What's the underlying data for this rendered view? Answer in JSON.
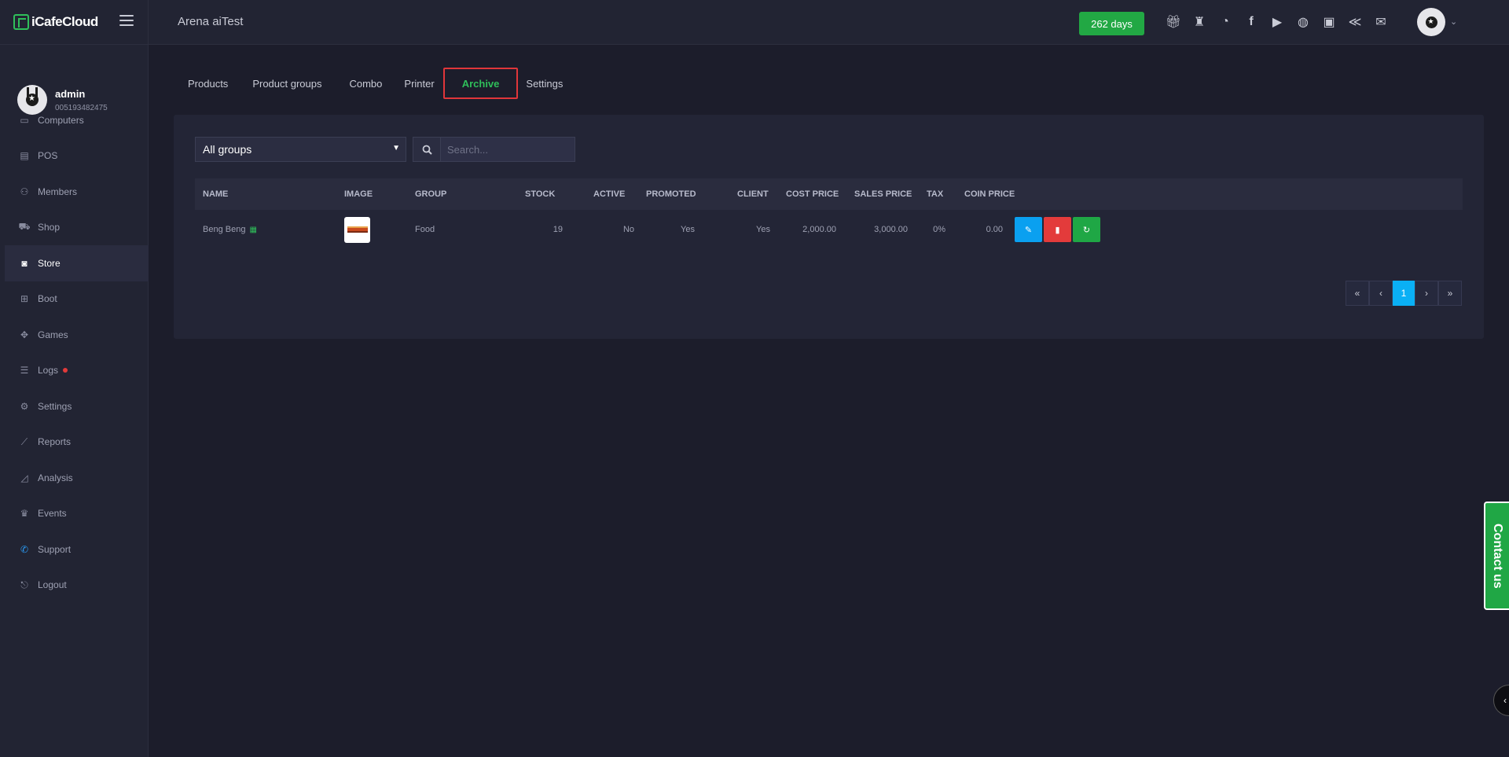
{
  "brand": {
    "name": "iCafeCloud"
  },
  "user": {
    "name": "admin",
    "phone": "005193482475"
  },
  "sidebar": {
    "items": [
      {
        "label": "Computers",
        "icon": "monitor-icon"
      },
      {
        "label": "POS",
        "icon": "cash-register-icon"
      },
      {
        "label": "Members",
        "icon": "users-icon"
      },
      {
        "label": "Shop",
        "icon": "cart-icon"
      },
      {
        "label": "Store",
        "icon": "bag-icon"
      },
      {
        "label": "Boot",
        "icon": "windows-icon"
      },
      {
        "label": "Games",
        "icon": "gamepad-icon"
      },
      {
        "label": "Logs",
        "icon": "list-icon"
      },
      {
        "label": "Settings",
        "icon": "gear-icon"
      },
      {
        "label": "Reports",
        "icon": "line-chart-icon"
      },
      {
        "label": "Analysis",
        "icon": "area-chart-icon"
      },
      {
        "label": "Events",
        "icon": "crown-icon"
      },
      {
        "label": "Support",
        "icon": "phone-icon"
      },
      {
        "label": "Logout",
        "icon": "logout-icon"
      }
    ],
    "active": "Store"
  },
  "header": {
    "title": "Arena aiTest",
    "days_badge": "262 days",
    "icons": [
      "gift-icon",
      "trophy-icon",
      "rss-icon",
      "facebook-icon",
      "youtube-icon",
      "globe-icon",
      "icafe-icon",
      "brand-chevron-icon",
      "mail-icon"
    ]
  },
  "tabs": [
    {
      "label": "Products"
    },
    {
      "label": "Product groups"
    },
    {
      "label": "Combo"
    },
    {
      "label": "Printer"
    },
    {
      "label": "Archive"
    },
    {
      "label": "Settings"
    }
  ],
  "active_tab": "Archive",
  "filters": {
    "group_select": "All groups",
    "search_placeholder": "Search..."
  },
  "table": {
    "columns": [
      "NAME",
      "IMAGE",
      "GROUP",
      "STOCK",
      "ACTIVE",
      "PROMOTED",
      "CLIENT",
      "COST PRICE",
      "SALES PRICE",
      "TAX",
      "COIN PRICE"
    ],
    "rows": [
      {
        "name": "Beng Beng",
        "group": "Food",
        "stock": "19",
        "active": "No",
        "promoted": "Yes",
        "client": "Yes",
        "cost_price": "2,000.00",
        "sales_price": "3,000.00",
        "tax": "0%",
        "coin_price": "0.00"
      }
    ]
  },
  "pagination": {
    "first": "«",
    "prev": "‹",
    "current": "1",
    "next": "›",
    "last": "»"
  },
  "contact": {
    "label": "Contact us"
  },
  "colors": {
    "accent_green": "#22a844",
    "accent_blue": "#0aa0f0",
    "danger": "#e33b3b",
    "background": "#1c1d2b"
  }
}
